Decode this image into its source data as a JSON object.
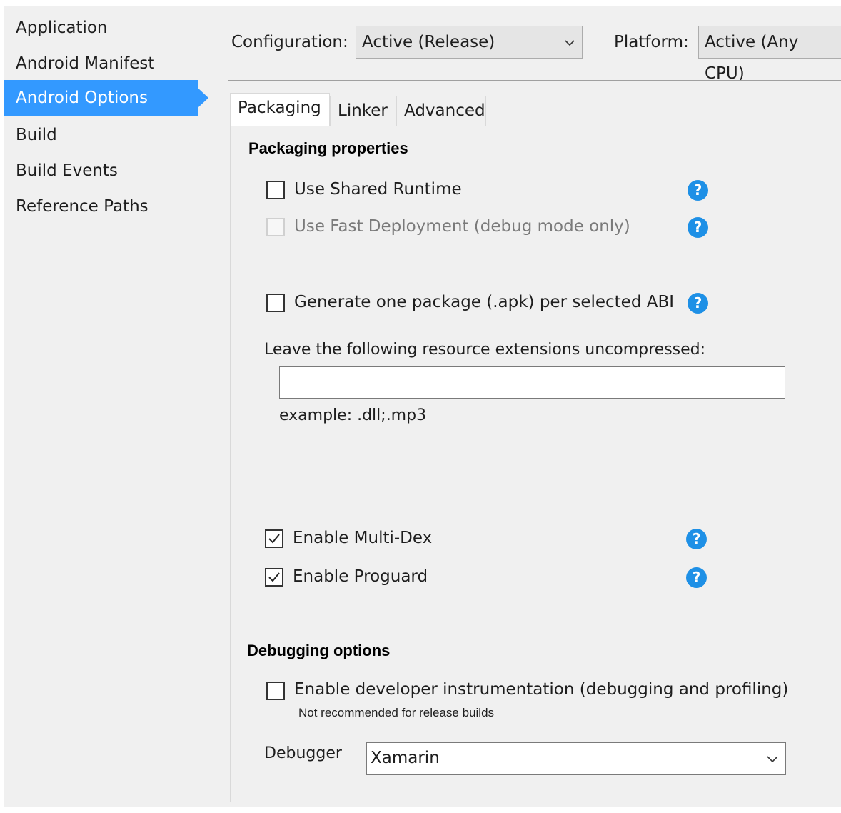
{
  "sidebar": {
    "items": [
      {
        "label": "Application"
      },
      {
        "label": "Android Manifest"
      },
      {
        "label": "Android Options",
        "active": true
      },
      {
        "label": "Build"
      },
      {
        "label": "Build Events"
      },
      {
        "label": "Reference Paths"
      }
    ]
  },
  "config": {
    "configuration_label": "Configuration:",
    "configuration_value": "Active (Release)",
    "platform_label": "Platform:",
    "platform_value": "Active (Any CPU)"
  },
  "tabs": [
    {
      "label": "Packaging",
      "active": true
    },
    {
      "label": "Linker"
    },
    {
      "label": "Advanced"
    }
  ],
  "packaging": {
    "title": "Packaging properties",
    "use_shared_runtime": {
      "label": "Use Shared Runtime",
      "checked": false,
      "enabled": true
    },
    "use_fast_deployment": {
      "label": "Use Fast Deployment (debug mode only)",
      "checked": false,
      "enabled": false
    },
    "one_package_per_abi": {
      "label": "Generate one package (.apk) per selected ABI",
      "checked": false,
      "enabled": true
    },
    "uncompressed_label": "Leave the following resource extensions uncompressed:",
    "uncompressed_value": "",
    "example_text": "example: .dll;.mp3",
    "multi_dex": {
      "label": "Enable Multi-Dex",
      "checked": true,
      "enabled": true
    },
    "proguard": {
      "label": "Enable Proguard",
      "checked": true,
      "enabled": true
    }
  },
  "debugging": {
    "title": "Debugging options",
    "instrumentation": {
      "label": "Enable developer instrumentation (debugging and profiling)",
      "checked": false
    },
    "instrumentation_note": "Not recommended for release builds",
    "debugger_label": "Debugger",
    "debugger_value": "Xamarin"
  },
  "help_glyph": "?",
  "colors": {
    "accent": "#3399ff",
    "help": "#1e90e6",
    "background": "#f0f0f0"
  }
}
